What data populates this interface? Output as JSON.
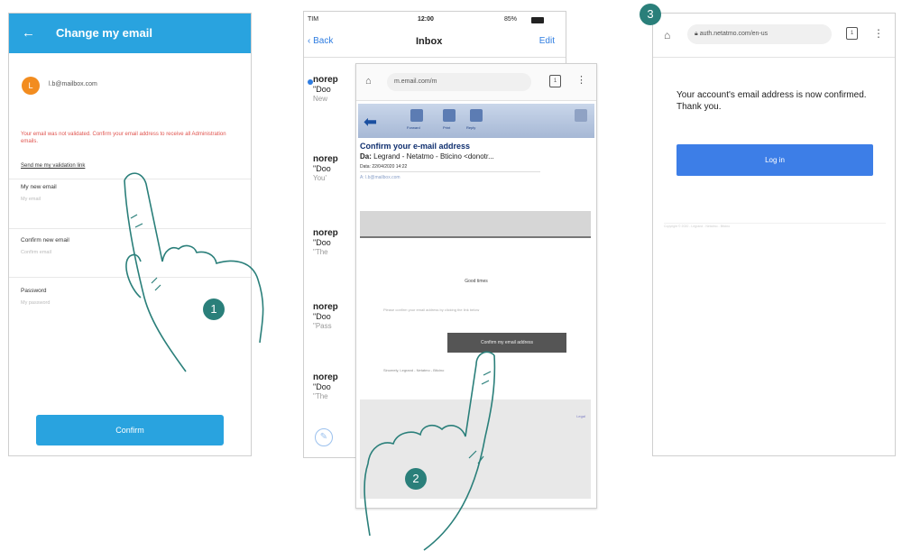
{
  "screen1": {
    "header_title": "Change my email",
    "back_icon": "arrow-left-icon",
    "avatar_initial": "L",
    "account_email": "l.b@mailbox.com",
    "warning_text": "Your email was not validated. Confirm your email address to receive all Administration emails.",
    "resend_link": "Send me my validation link",
    "fields": [
      {
        "label": "My new email",
        "placeholder": "My email"
      },
      {
        "label": "Confirm new email",
        "placeholder": "Confirm email"
      },
      {
        "label": "Password",
        "placeholder": "My password"
      }
    ],
    "confirm_label": "Confirm",
    "accent": "#29a3df"
  },
  "screen2": {
    "status": {
      "carrier": "TIM",
      "time": "12:00",
      "battery": "85%"
    },
    "nav": {
      "back": "Back",
      "title": "Inbox",
      "edit": "Edit"
    },
    "mails": [
      {
        "from": "norep",
        "subject": "\"Doo",
        "preview": "New",
        "unread": true
      },
      {
        "from": "norep",
        "subject": "\"Doo",
        "preview": "You'",
        "unread": false
      },
      {
        "from": "norep",
        "subject": "\"Doo",
        "preview": "\"The",
        "unread": false
      },
      {
        "from": "norep",
        "subject": "\"Doo",
        "preview": "\"Pass",
        "unread": false
      },
      {
        "from": "norep",
        "subject": "\"Doo",
        "preview": "\"The",
        "unread": false
      }
    ],
    "browser": {
      "url": "m.email.com/m",
      "tabs_count": "1",
      "toolbar": [
        "Reply",
        "Forward",
        "Print",
        "Delete"
      ],
      "email_subject": "Confirm your e-mail address",
      "email_from_prefix": "Da:",
      "email_from": "Legrand - Netatmo - Bticino <donotr...",
      "email_date": "Data: 22/04/2020 14:22",
      "email_to": "A: l.b@mailbox.com",
      "greeting": "Good times",
      "body": "Please confirm your email address by clicking the link below",
      "button": "Confirm my email address",
      "signature": "Sincerely, Legrand - Netatmo - Bticino",
      "footer_link": "Legal"
    }
  },
  "screen3": {
    "url": "auth.netatmo.com/en-us",
    "tabs_count": "1",
    "message": "Your account's email address is now confirmed. Thank you.",
    "login_label": "Log in",
    "footer": "Copyright © 2020 - Legrand - Netatmo - Bticino"
  },
  "steps": [
    "1",
    "2",
    "3"
  ],
  "badge_color": "#2a7f7a"
}
